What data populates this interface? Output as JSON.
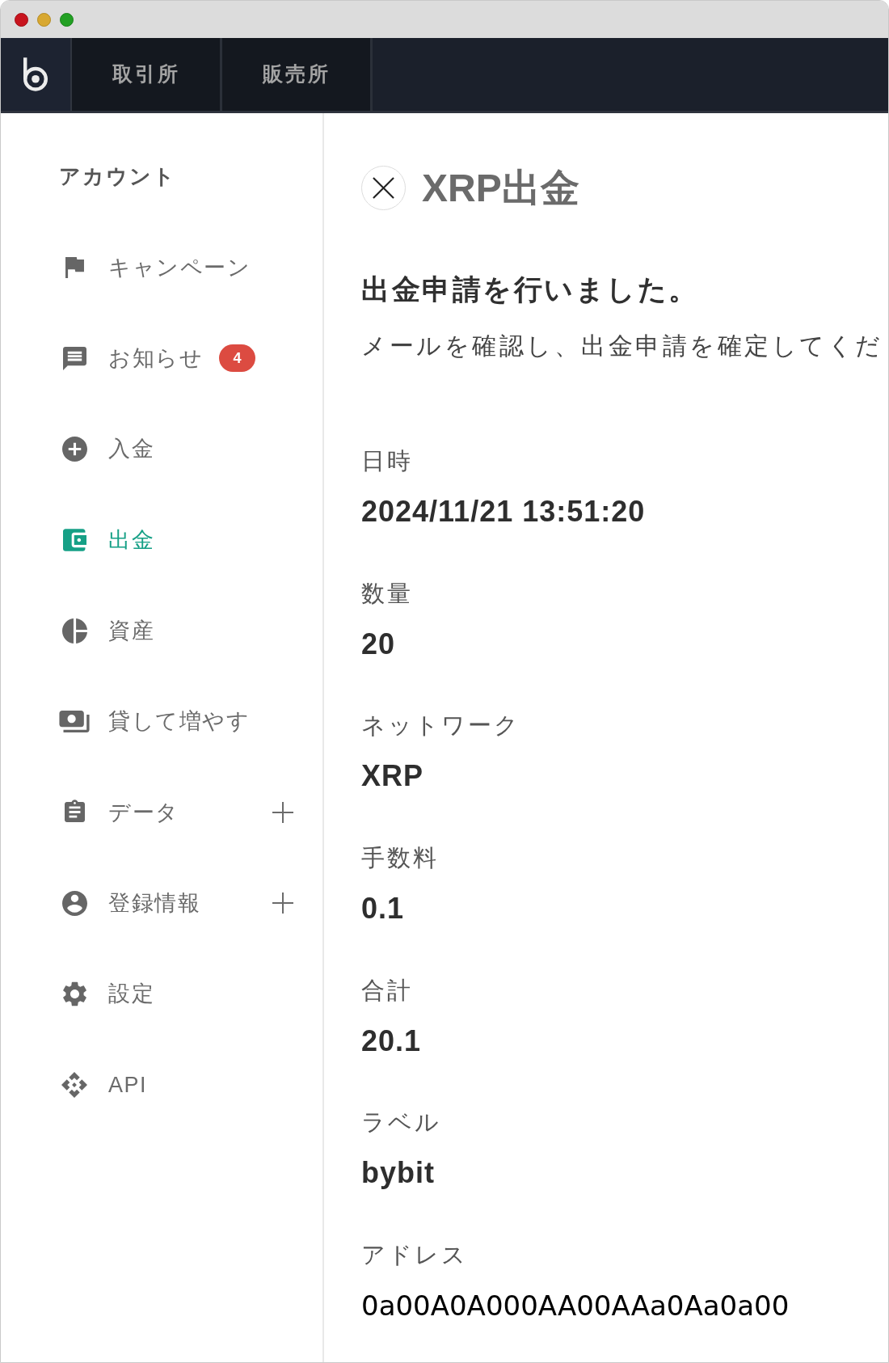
{
  "nav": {
    "tabs": [
      {
        "label": "取引所",
        "selected": false
      },
      {
        "label": "販売所",
        "selected": false
      }
    ]
  },
  "sidebar": {
    "heading": "アカウント",
    "items": [
      {
        "label": "キャンペーン",
        "selected": false
      },
      {
        "label": "お知らせ",
        "badge": "4",
        "selected": false
      },
      {
        "label": "入金",
        "selected": false
      },
      {
        "label": "出金",
        "selected": true
      },
      {
        "label": "資産",
        "selected": false
      },
      {
        "label": "貸して増やす",
        "selected": false
      },
      {
        "label": "データ",
        "expanded": false,
        "selected": false
      },
      {
        "label": "登録情報",
        "expanded": false,
        "selected": false
      },
      {
        "label": "設定",
        "selected": false
      },
      {
        "label": "API",
        "selected": false
      }
    ]
  },
  "page": {
    "title": "XRP出金",
    "message": {
      "heading": "出金申請を行いました。",
      "body": "メールを確認し、出金申請を確定してくだ"
    },
    "fields": [
      {
        "label": "日時",
        "value": "2024/11/21 13:51:20",
        "kind": "text"
      },
      {
        "label": "数量",
        "value": "20",
        "kind": "text"
      },
      {
        "label": "ネットワーク",
        "value": "XRP",
        "kind": "text"
      },
      {
        "label": "手数料",
        "value": "0.1",
        "kind": "text"
      },
      {
        "label": "合計",
        "value": "20.1",
        "kind": "text"
      },
      {
        "label": "ラベル",
        "value": "bybit",
        "kind": "text"
      },
      {
        "label": "アドレス",
        "value": "0a00A0A000AA00AAa0Aa0a00",
        "kind": "address"
      }
    ]
  }
}
